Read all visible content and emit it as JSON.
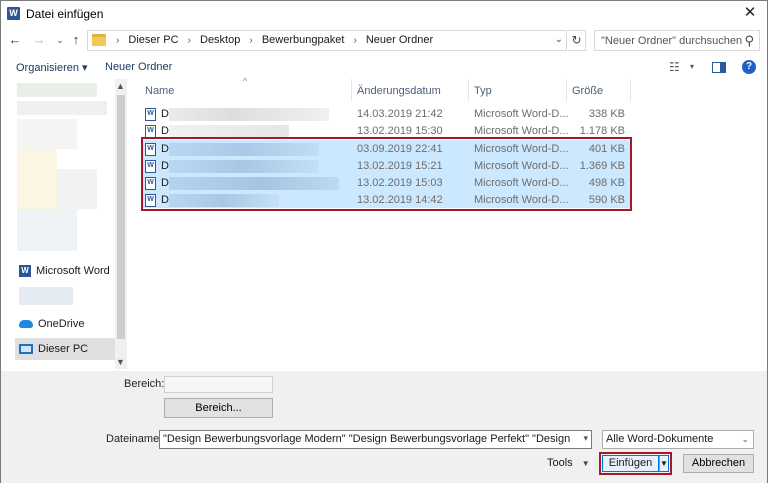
{
  "window": {
    "title": "Datei einfügen",
    "close_glyph": "✕"
  },
  "nav": {
    "back_glyph": "←",
    "forward_glyph": "→",
    "recent_glyph": "⌄",
    "up_glyph": "↑",
    "refresh_glyph": "↻"
  },
  "breadcrumb": {
    "separator": "›",
    "items": [
      "Dieser PC",
      "Desktop",
      "Bewerbungpaket",
      "Neuer Ordner"
    ]
  },
  "search": {
    "placeholder": "\"Neuer Ordner\" durchsuchen",
    "icon": "search-icon"
  },
  "toolbar": {
    "organize_label": "Organisieren ▾",
    "new_folder_label": "Neuer Ordner"
  },
  "sidebar": {
    "items": [
      {
        "label": "Microsoft Word",
        "icon": "word-icon"
      },
      {
        "label": "OneDrive",
        "icon": "onedrive-icon"
      },
      {
        "label": "Dieser PC",
        "icon": "computer-icon",
        "selected": true
      }
    ]
  },
  "columns": {
    "name": "Name",
    "date": "Änderungsdatum",
    "type": "Typ",
    "size": "Größe"
  },
  "files": [
    {
      "name": "D",
      "date": "14.03.2019 21:42",
      "type": "Microsoft Word-D...",
      "size": "338 KB",
      "selected": false
    },
    {
      "name": "D",
      "date": "13.02.2019 15:30",
      "type": "Microsoft Word-D...",
      "size": "1.178 KB",
      "selected": false
    },
    {
      "name": "D",
      "date": "03.09.2019 22:41",
      "type": "Microsoft Word-D...",
      "size": "401 KB",
      "selected": true
    },
    {
      "name": "D",
      "date": "13.02.2019 15:21",
      "type": "Microsoft Word-D...",
      "size": "1.369 KB",
      "selected": true
    },
    {
      "name": "D",
      "date": "13.02.2019 15:03",
      "type": "Microsoft Word-D...",
      "size": "498 KB",
      "selected": true
    },
    {
      "name": "D",
      "date": "13.02.2019 14:42",
      "type": "Microsoft Word-D...",
      "size": "590 KB",
      "selected": true
    }
  ],
  "bottom": {
    "range_label": "Bereich:",
    "range_value": "",
    "range_button": "Bereich...",
    "filename_label": "Dateiname:",
    "filename_value": "\"Design Bewerbungsvorlage Modern\" \"Design Bewerbungsvorlage Perfekt\" \"Design Bewerbungsv",
    "filter_value": "Alle Word-Dokumente",
    "tools_label": "Tools",
    "insert_label": "Einfügen",
    "cancel_label": "Abbrechen"
  },
  "colors": {
    "accent": "#0078d7",
    "selection": "#cce8ff",
    "highlight_box": "#a3182b"
  }
}
